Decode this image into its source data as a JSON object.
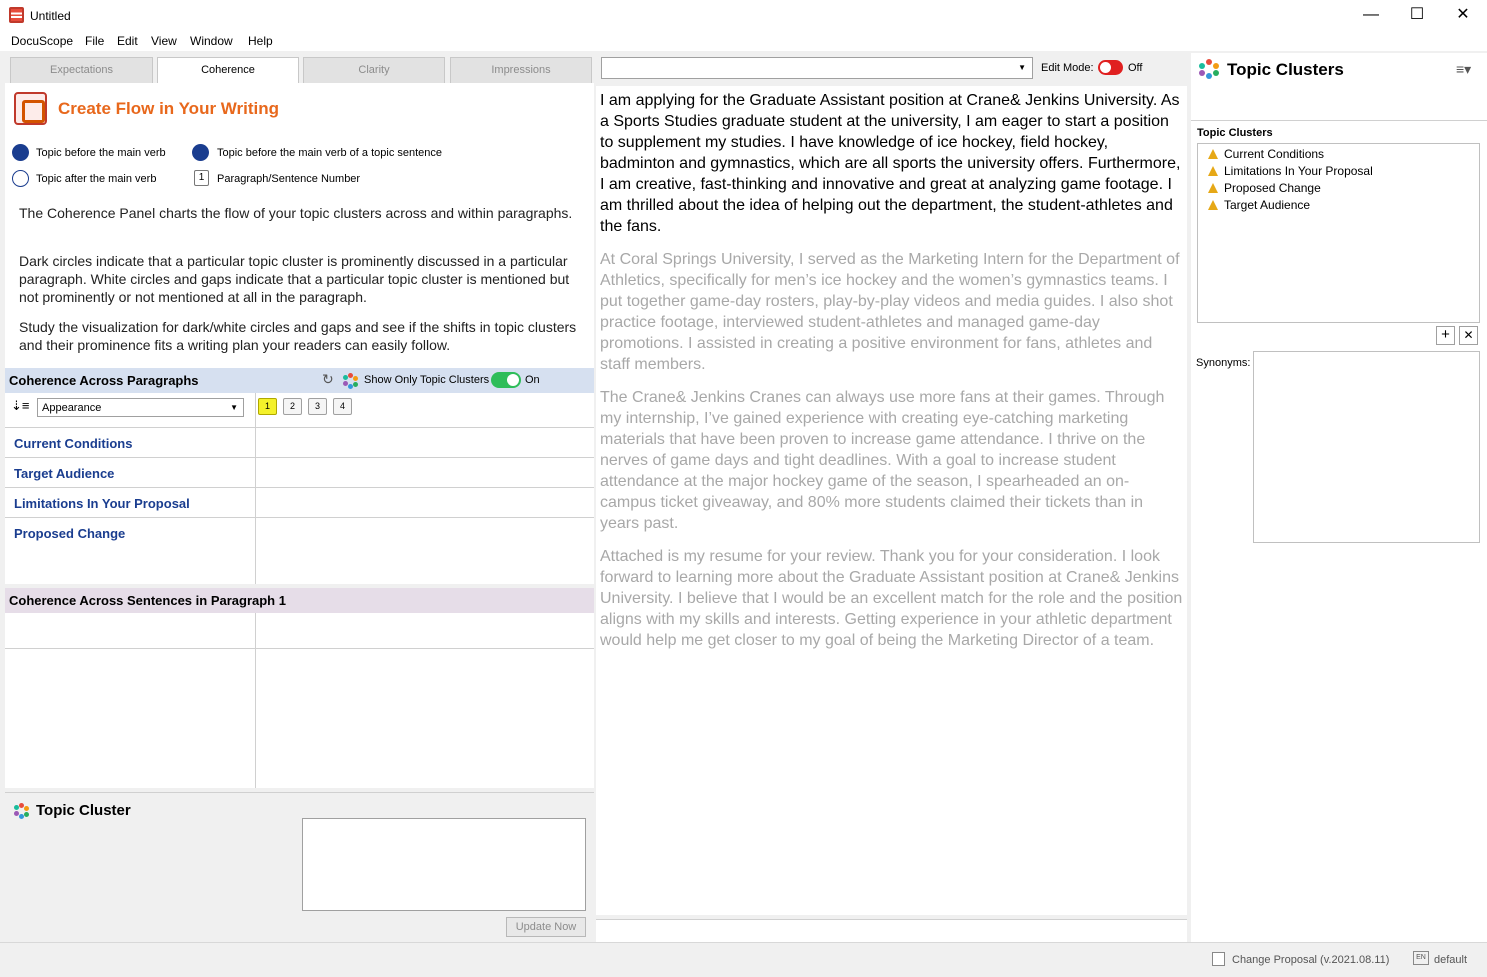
{
  "window": {
    "title": "Untitled",
    "minimize": "—",
    "maximize": "☐",
    "close": "✕"
  },
  "menu": [
    "DocuScope",
    "File",
    "Edit",
    "View",
    "Window",
    "Help"
  ],
  "tabs": [
    "Expectations",
    "Coherence",
    "Clarity",
    "Impressions"
  ],
  "left": {
    "title": "Create Flow in Your Writing",
    "legend": {
      "dark_before": "Topic before the main verb",
      "dark_topic_sentence": "Topic before the main verb of a topic sentence",
      "white_after": "Topic after the main verb",
      "number_box": "1",
      "number_label": "Paragraph/Sentence Number"
    },
    "paragraphs": [
      "The Coherence Panel charts the flow of your topic clusters across and within paragraphs.",
      "Dark circles indicate that a particular topic cluster is prominently discussed in a particular paragraph. White circles and gaps indicate that a particular topic cluster is mentioned but not prominently or not mentioned at all in the paragraph.",
      "Study the visualization for dark/white circles and gaps and see if the shifts in topic clusters and their prominence fits a writing plan your readers can easily follow."
    ],
    "across_paragraphs": {
      "header": "Coherence Across Paragraphs",
      "show_only_label": "Show Only Topic Clusters",
      "toggle_state": "On",
      "sort_value": "Appearance",
      "paragraph_numbers": [
        "1",
        "2",
        "3",
        "4"
      ],
      "rows": [
        "Current Conditions",
        "Target Audience",
        "Limitations In Your Proposal",
        "Proposed Change"
      ]
    },
    "across_sentences": {
      "header": "Coherence Across Sentences in Paragraph 1"
    },
    "topic_cluster": {
      "title": "Topic Cluster",
      "update_button": "Update Now"
    }
  },
  "middle": {
    "combo_value": "",
    "edit_mode_label": "Edit Mode:",
    "edit_mode_state": "Off",
    "document": [
      "I am applying for the Graduate Assistant position at Crane& Jenkins University. As a Sports Studies graduate student at the university, I am eager to start a position to supplement my studies. I have knowledge of ice hockey, field hockey, badminton and gymnastics, which are all sports the university offers. Furthermore, I am creative, fast-thinking and innovative and great at analyzing game footage. I am thrilled about the idea of helping out the department, the student-athletes and the fans.",
      "At Coral Springs University, I served as the Marketing Intern for the Department of Athletics, specifically for men’s ice hockey and the women’s gymnastics teams. I put together game-day rosters, play-by-play videos and media guides. I also shot practice footage, interviewed student-athletes and managed game-day promotions. I assisted in creating a positive environment for fans, athletes and staff members.",
      "The Crane& Jenkins Cranes can always use more fans at their games. Through my internship, I’ve gained experience with creating eye-catching marketing materials that have been proven to increase game attendance. I thrive on the nerves of game days and tight deadlines. With a goal to increase student attendance at the major hockey game of the season, I spearheaded an on-campus ticket giveaway, and 80% more students claimed their tickets than in years past.",
      "Attached is my resume for your review. Thank you for your consideration. I look forward to learning more about the Graduate Assistant position at Crane& Jenkins University. I believe that I would be an excellent match for the role and the position aligns with my skills and interests. Getting experience in your athletic department would help me get closer to my goal of being the Marketing Director of a team."
    ]
  },
  "right": {
    "title": "Topic Clusters",
    "list_label": "Topic Clusters",
    "items": [
      "Current Conditions",
      "Limitations In Your Proposal",
      "Proposed Change",
      "Target Audience"
    ],
    "add": "+",
    "remove": "✕",
    "synonyms_label": "Synonyms:"
  },
  "status": {
    "project": "Change Proposal (v.2021.08.11)",
    "language": "default",
    "lang_badge": "EN"
  },
  "colors": {
    "accent_orange": "#e8681c",
    "dark_blue": "#1a3d8f",
    "toggle_green": "#2ebd59",
    "toggle_red": "#e02020",
    "highlight_yellow": "#f4f12a"
  }
}
